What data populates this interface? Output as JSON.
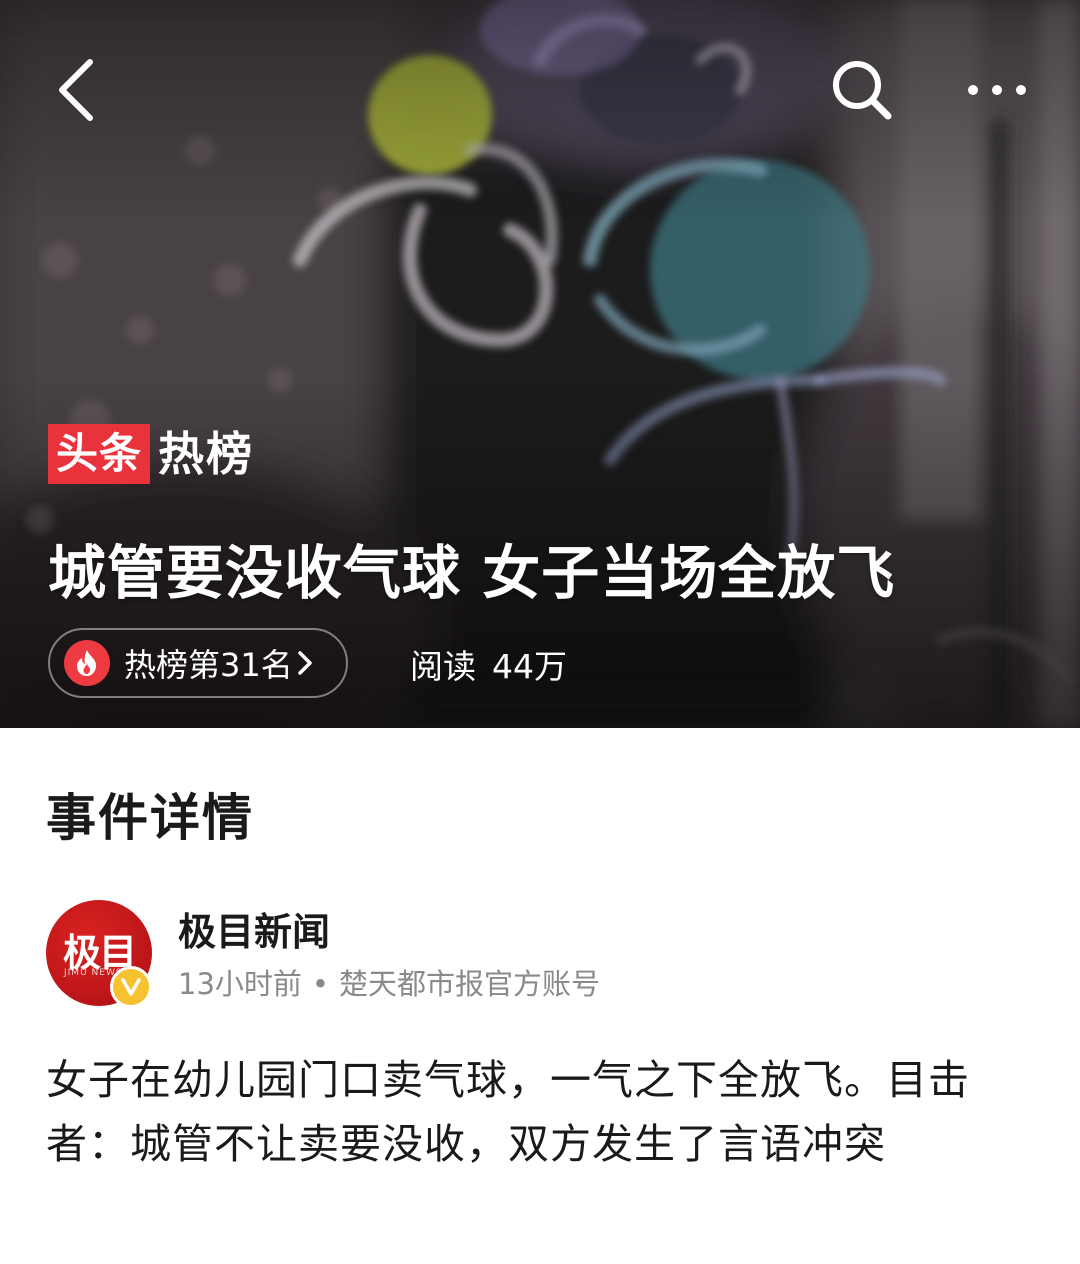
{
  "hero": {
    "brand_red": "头条",
    "brand_white": "热榜",
    "headline": "城管要没收气球 女子当场全放飞",
    "rank_label": "热榜第31名",
    "reads_label": "阅读",
    "reads_count": "44万"
  },
  "icons": {
    "back": "back-arrow-icon",
    "search": "search-icon",
    "more": "more-dots-icon",
    "fire": "fire-icon",
    "chevron": "chevron-right-icon",
    "verified": "verified-v-icon"
  },
  "section": {
    "title": "事件详情"
  },
  "author": {
    "name": "极目新闻",
    "avatar_text": "极目",
    "avatar_sub": "JIMU NEWS",
    "time": "13小时前",
    "separator": "•",
    "description": "楚天都市报官方账号"
  },
  "article": {
    "body": "女子在幼儿园门口卖气球，一气之下全放飞。目击者：城管不让卖要没收，双方发生了言语冲突"
  },
  "colors": {
    "accent_red": "#e8323c",
    "fire_red": "#ee3a41",
    "avatar_red": "#c0171a",
    "verified_yellow": "#f6c22f",
    "text_primary": "#1a1a1a",
    "text_secondary": "#8a8a8a"
  }
}
